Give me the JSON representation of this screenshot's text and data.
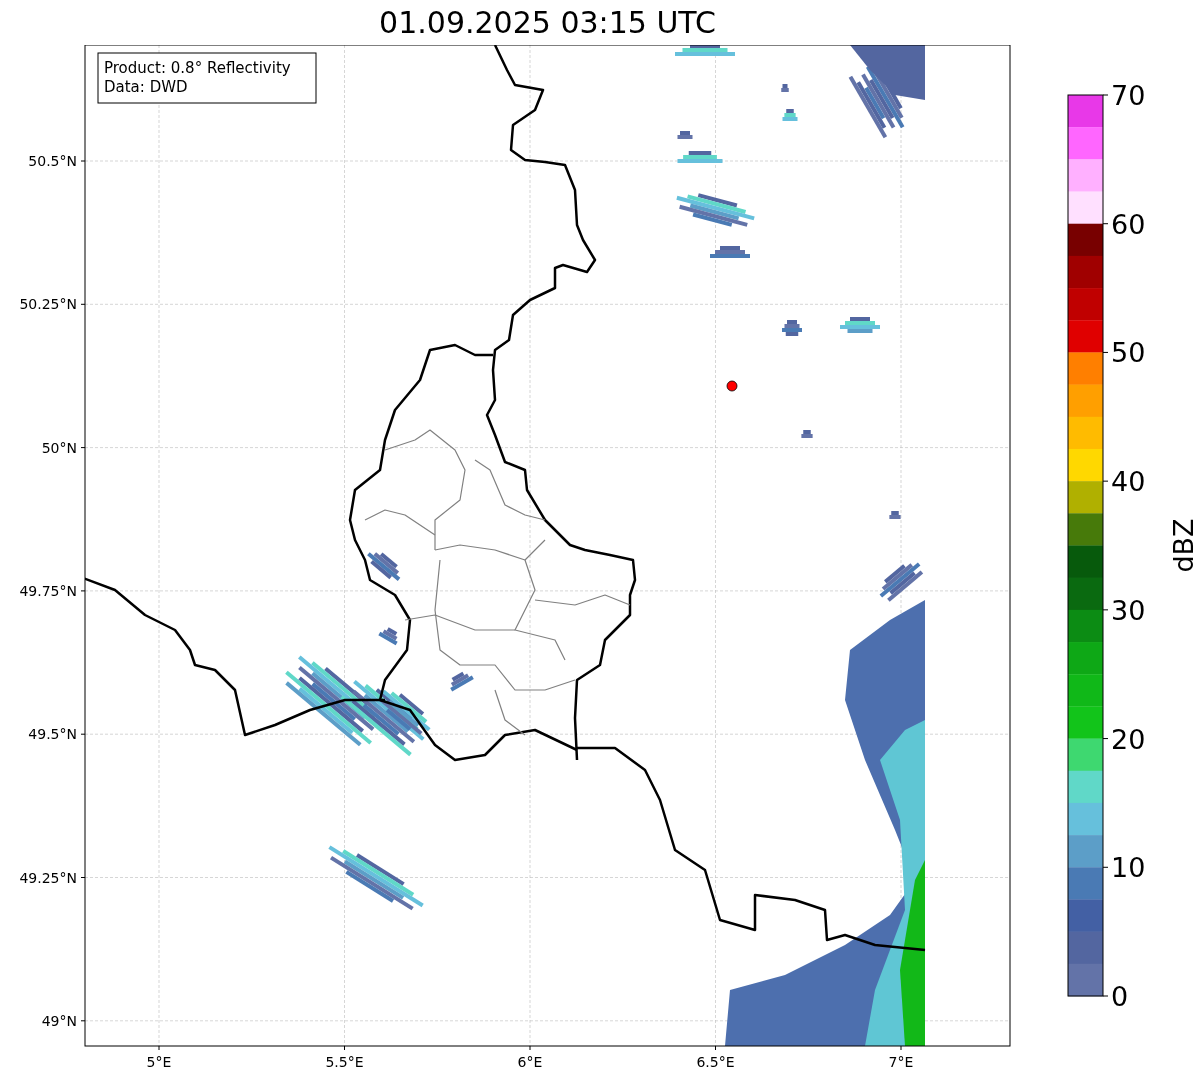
{
  "title": "01.09.2025 03:15 UTC",
  "map": {
    "info_box": [
      "Product: 0.8° Reflectivity",
      "Data: DWD"
    ],
    "lat_labels": [
      "50.5°N",
      "50.25°N",
      "50°N",
      "49.75°N",
      "49.5°N",
      "49.25°N",
      "49°N"
    ],
    "lon_labels": [
      "5°E",
      "5.5°E",
      "6°E",
      "6.5°E",
      "7°E"
    ]
  },
  "colorbar": {
    "label": "dBZ",
    "tick_labels": [
      "70",
      "60",
      "50",
      "40",
      "30",
      "20",
      "10",
      "0"
    ],
    "bands": [
      {
        "color": "#e838e8"
      },
      {
        "color": "#ff66ff"
      },
      {
        "color": "#ffb0ff"
      },
      {
        "color": "#ffe0ff"
      },
      {
        "color": "#780000"
      },
      {
        "color": "#a00000"
      },
      {
        "color": "#c00000"
      },
      {
        "color": "#e00000"
      },
      {
        "color": "#ff7f00"
      },
      {
        "color": "#ff9f00"
      },
      {
        "color": "#ffbb00"
      },
      {
        "color": "#ffd800"
      },
      {
        "color": "#b0b000"
      },
      {
        "color": "#477a0a"
      },
      {
        "color": "#075a0c"
      },
      {
        "color": "#0a6a10"
      },
      {
        "color": "#0c8c14"
      },
      {
        "color": "#0ea816"
      },
      {
        "color": "#10b818"
      },
      {
        "color": "#12c41a"
      },
      {
        "color": "#3ed870"
      },
      {
        "color": "#60d8c8"
      },
      {
        "color": "#66c0dc"
      },
      {
        "color": "#5c9ec8"
      },
      {
        "color": "#4a7ab4"
      },
      {
        "color": "#4360a4"
      },
      {
        "color": "#5366a0"
      },
      {
        "color": "#6373a8"
      }
    ]
  }
}
